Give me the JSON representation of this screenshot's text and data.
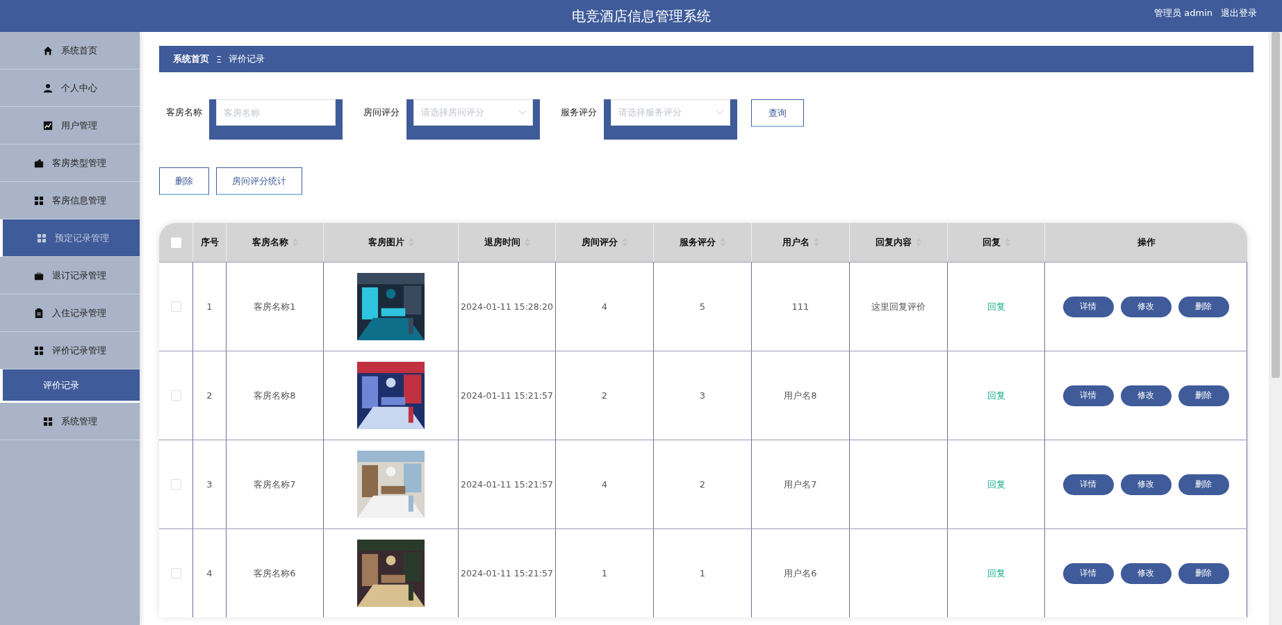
{
  "header": {
    "title": "电竞酒店信息管理系统",
    "user": "管理员 admin",
    "logout": "退出登录"
  },
  "sidebar": {
    "items": [
      {
        "label": "系统首页",
        "selected": false
      },
      {
        "label": "个人中心",
        "selected": false
      },
      {
        "label": "用户管理",
        "selected": false
      },
      {
        "label": "客房类型管理",
        "selected": false
      },
      {
        "label": "客房信息管理",
        "selected": false
      },
      {
        "label": "预定记录管理",
        "selected": true
      },
      {
        "label": "退订记录管理",
        "selected": false
      },
      {
        "label": "入住记录管理",
        "selected": false
      },
      {
        "label": "评价记录管理",
        "selected": false,
        "children": [
          {
            "label": "评价记录",
            "selected": true
          }
        ]
      },
      {
        "label": "系统管理",
        "selected": false
      }
    ]
  },
  "breadcrumb": {
    "home": "系统首页",
    "separator": "Ξ",
    "current": "评价记录"
  },
  "filters": [
    {
      "kind": "input",
      "label": "客房名称",
      "placeholder": "客房名称"
    },
    {
      "kind": "select",
      "label": "房间评分",
      "placeholder": "请选择房间评分"
    },
    {
      "kind": "select",
      "label": "服务评分",
      "placeholder": "请选择服务评分"
    }
  ],
  "search_button": "查询",
  "actions": [
    "删除",
    "房间评分统计"
  ],
  "table": {
    "select_all_checked": false,
    "columns": [
      {
        "label": "序号",
        "sortable": false
      },
      {
        "label": "客房名称",
        "sortable": true
      },
      {
        "label": "客房图片",
        "sortable": true
      },
      {
        "label": "退房时间",
        "sortable": true
      },
      {
        "label": "房间评分",
        "sortable": true
      },
      {
        "label": "服务评分",
        "sortable": true
      },
      {
        "label": "用户名",
        "sortable": true
      },
      {
        "label": "回复内容",
        "sortable": true
      },
      {
        "label": "回复",
        "sortable": true
      },
      {
        "label": "操作",
        "sortable": false
      }
    ],
    "rows": [
      {
        "checked": false,
        "index": "1",
        "room": "客房名称1",
        "picture": {
          "kind": "picture"
        },
        "checkout": "2024-01-11 15:28:20",
        "room_score": "4",
        "service_score": "5",
        "user": "111",
        "reply_content": "这里回复评价",
        "reply": "回复",
        "buttons": [
          "详情",
          "修改",
          "删除"
        ]
      },
      {
        "checked": false,
        "index": "2",
        "room": "客房名称8",
        "picture": {
          "kind": "picture"
        },
        "checkout": "2024-01-11 15:21:57",
        "room_score": "2",
        "service_score": "3",
        "user": "用户名8",
        "reply": "回复",
        "buttons": [
          "详情",
          "修改",
          "删除"
        ]
      },
      {
        "checked": false,
        "index": "3",
        "room": "客房名称7",
        "picture": {
          "kind": "picture"
        },
        "checkout": "2024-01-11 15:21:57",
        "room_score": "4",
        "service_score": "2",
        "user": "用户名7",
        "reply": "回复",
        "buttons": [
          "详情",
          "修改",
          "删除"
        ]
      },
      {
        "checked": false,
        "index": "4",
        "room": "客房名称6",
        "picture": {
          "kind": "picture"
        },
        "checkout": "2024-01-11 15:21:57",
        "room_score": "1",
        "service_score": "1",
        "user": "用户名6",
        "reply": "回复",
        "buttons": [
          "详情",
          "修改",
          "删除"
        ]
      }
    ]
  }
}
